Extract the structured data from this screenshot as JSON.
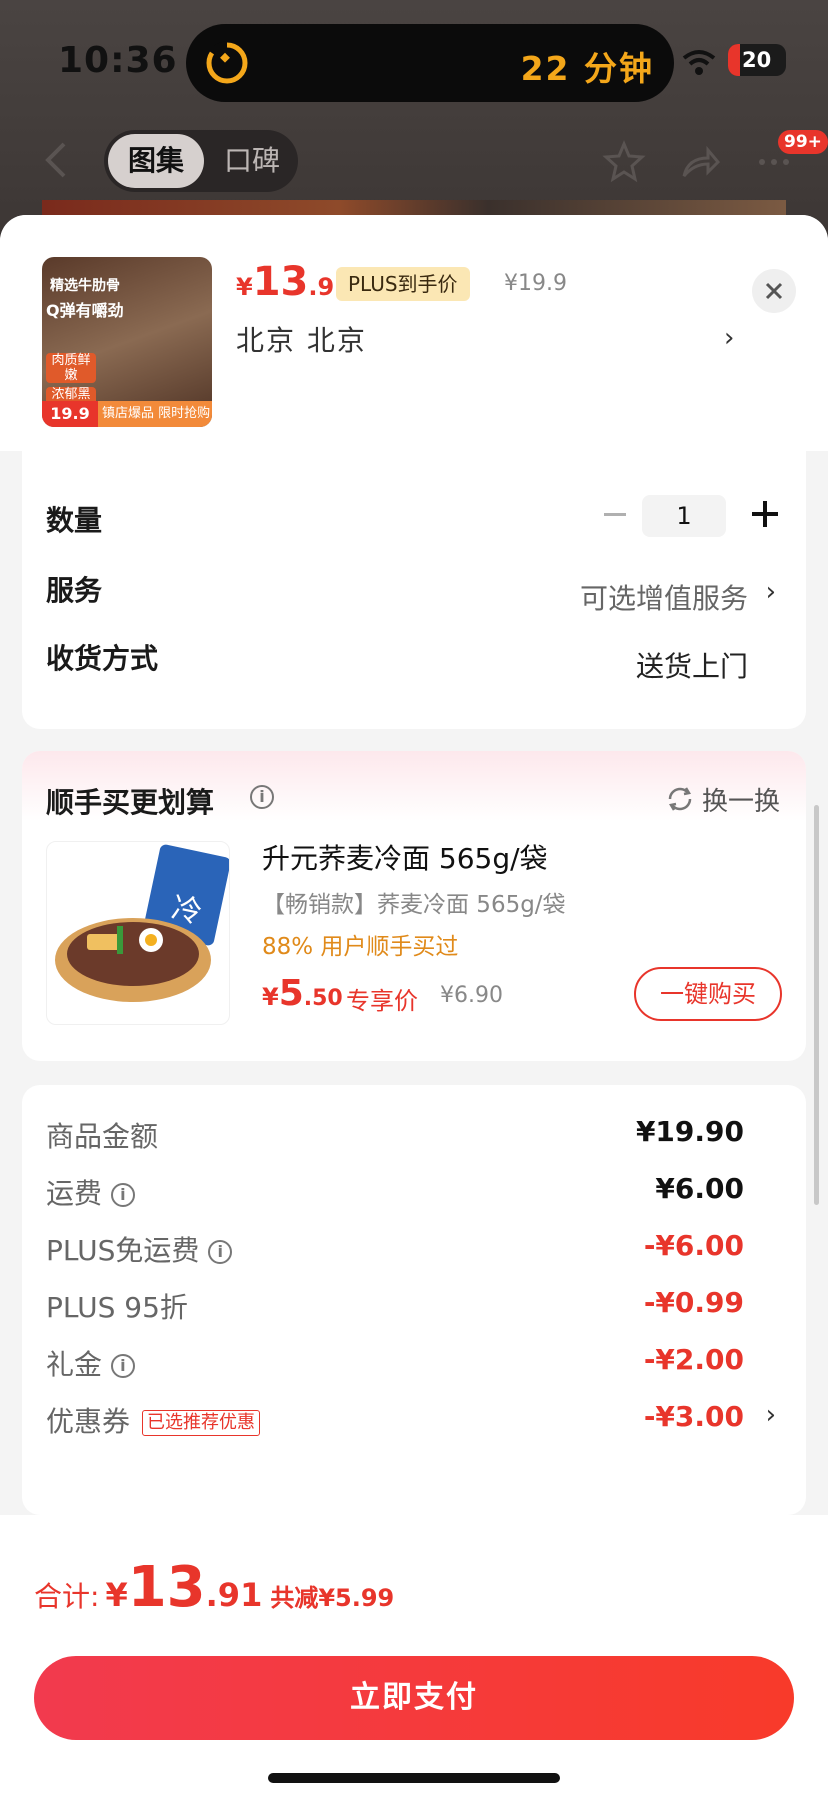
{
  "status_bar": {
    "time": "10:36",
    "activity_text": "22 分钟",
    "battery": "20"
  },
  "nav": {
    "tab_active": "图集",
    "tab_inactive": "口碑",
    "badge": "99+"
  },
  "product": {
    "image_text_1": "精选牛肋骨",
    "image_text_2": "Q弹有嚼劲",
    "image_tag_1": "肉质鲜嫩",
    "image_tag_2": "浓郁黑椒",
    "image_price": "19.9",
    "image_strip": "镇店爆品 限时抢购",
    "price_symbol": "¥",
    "price_int": "13",
    "price_dec": ".91",
    "plus_label": "PLUS到手价",
    "orig_price": "¥19.9",
    "address": "北京  北京"
  },
  "options": {
    "qty_label": "数量",
    "qty_value": "1",
    "service_label": "服务",
    "service_value": "可选增值服务",
    "delivery_label": "收货方式",
    "delivery_value": "送货上门"
  },
  "addon": {
    "title": "顺手买更划算",
    "swap_label": "换一换",
    "item_title": "升元荞麦冷面 565g/袋",
    "item_sub": "【畅销款】荞麦冷面 565g/袋",
    "item_pct": "88% 用户顺手买过",
    "price_symbol": "¥",
    "price_int": "5",
    "price_dec": ".50",
    "excl_label": "专享价",
    "orig_price": "¥6.90",
    "buy_label": "一键购买"
  },
  "fees": [
    {
      "label": "商品金额",
      "value": "¥19.90"
    },
    {
      "label": "运费",
      "value": "¥6.00"
    },
    {
      "label": "PLUS免运费",
      "value": "-¥6.00"
    },
    {
      "label": "PLUS 95折",
      "value": "-¥0.99"
    },
    {
      "label": "礼金",
      "value": "-¥2.00"
    },
    {
      "label": "优惠券",
      "value": "-¥3.00",
      "tag": "已选推荐优惠"
    }
  ],
  "footer": {
    "total_label": "合计:",
    "total_symbol": "¥",
    "total_int": "13",
    "total_dec": ".91",
    "saved": "共减¥5.99",
    "pay_label": "立即支付"
  },
  "colors": {
    "accent": "#e8352b",
    "plus_gold": "#fbe7b4",
    "timer": "#f4a71a"
  }
}
